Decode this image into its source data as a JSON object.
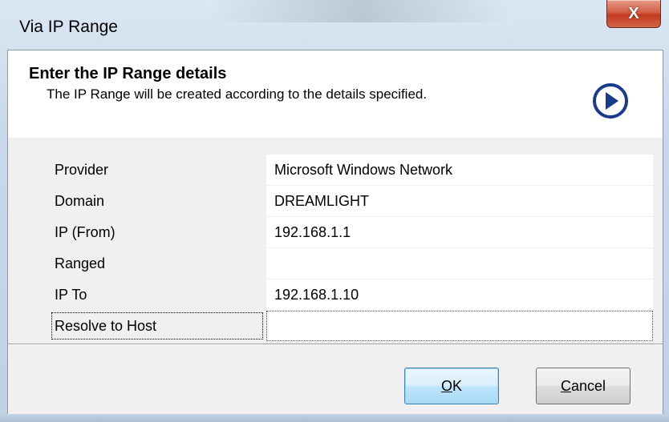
{
  "window": {
    "title": "Via IP Range",
    "close_glyph": "X"
  },
  "header": {
    "title": "Enter the IP Range details",
    "subtitle": "The IP Range will be created according to the details specified.",
    "icon": "next-arrow-icon"
  },
  "properties": [
    {
      "label": "Provider",
      "value": "Microsoft Windows Network",
      "type": "text"
    },
    {
      "label": "Domain",
      "value": "DREAMLIGHT",
      "type": "text"
    },
    {
      "label": "IP (From)",
      "value": "192.168.1.1",
      "type": "text"
    },
    {
      "label": "Ranged",
      "checked": true,
      "type": "checkbox"
    },
    {
      "label": "IP To",
      "value": "192.168.1.10",
      "type": "text"
    },
    {
      "label": "Resolve to Host",
      "checked": true,
      "type": "checkbox"
    }
  ],
  "buttons": {
    "ok_prefix": "O",
    "ok_rest": "K",
    "cancel_prefix": "C",
    "cancel_rest": "ancel"
  },
  "colors": {
    "icon_blue": "#1a3a8c",
    "close_red": "#c2391f"
  }
}
